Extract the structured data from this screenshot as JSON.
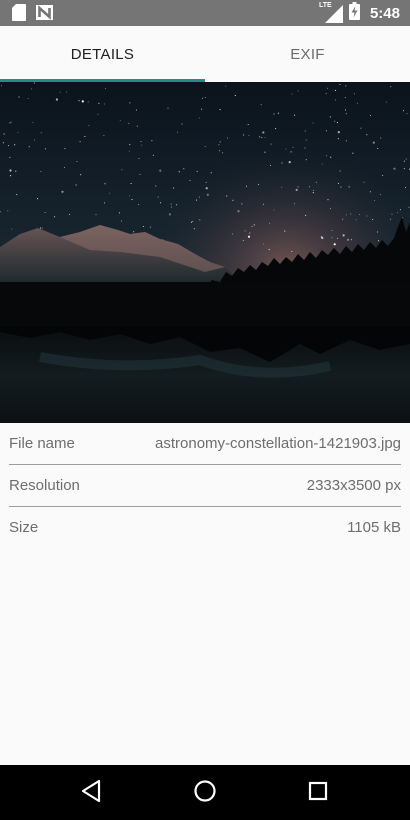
{
  "status_bar": {
    "time": "5:48",
    "network": "LTE",
    "icons": [
      "sd-card-icon",
      "n-notification-icon",
      "lte-signal-icon",
      "battery-charging-icon"
    ]
  },
  "tabs": [
    {
      "label": "DETAILS",
      "active": true
    },
    {
      "label": "EXIF",
      "active": false
    }
  ],
  "photo": {
    "description_icon": "starry-mountain-lake-image"
  },
  "details": {
    "file_name": {
      "label": "File name",
      "value": "astronomy-constellation-1421903.jpg"
    },
    "resolution": {
      "label": "Resolution",
      "value": "2333x3500 px"
    },
    "size": {
      "label": "Size",
      "value": "1105 kB"
    }
  },
  "nav_bar": {
    "icons": [
      "back-icon",
      "home-icon",
      "recents-icon"
    ]
  },
  "colors": {
    "accent": "#1f8f86",
    "status_bar": "#757575",
    "background": "#fafafa",
    "nav_bar": "#000000"
  }
}
